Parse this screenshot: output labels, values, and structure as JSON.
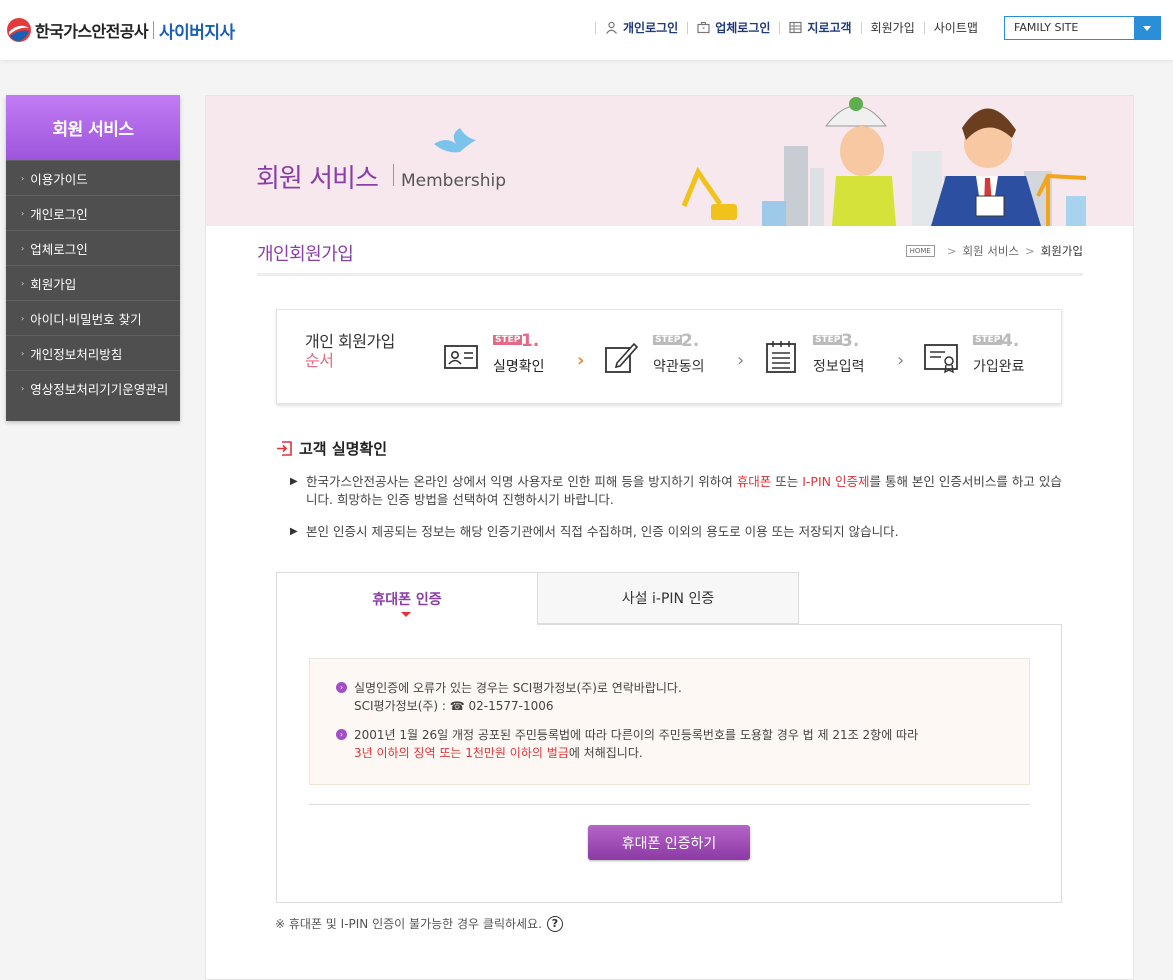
{
  "header": {
    "logo_text": "한국가스안전공사",
    "logo_sub": "사이버지사",
    "nav": [
      {
        "label": "개인로그인"
      },
      {
        "label": "업체로그인"
      },
      {
        "label": "지로고객"
      },
      {
        "label": "회원가입"
      },
      {
        "label": "사이트맵"
      }
    ],
    "family_site": "FAMILY SITE"
  },
  "sidebar": {
    "title": "회원 서비스",
    "items": [
      {
        "label": "이용가이드"
      },
      {
        "label": "개인로그인"
      },
      {
        "label": "업체로그인"
      },
      {
        "label": "회원가입"
      },
      {
        "label": "아이디·비밀번호 찾기"
      },
      {
        "label": "개인정보처리방침"
      },
      {
        "label": "영상정보처리기기운영관리"
      }
    ]
  },
  "banner": {
    "title": "회원 서비스",
    "subtitle": "Membership"
  },
  "page": {
    "title": "개인회원가입",
    "breadcrumb": {
      "home": "HOME",
      "level1": "회원 서비스",
      "level2": "회원가입"
    }
  },
  "steps": {
    "title_line1": "개인 회원가입",
    "title_line2": "순서",
    "badge": "STEP",
    "items": [
      {
        "num": "1.",
        "name": "실명확인"
      },
      {
        "num": "2.",
        "name": "약관동의"
      },
      {
        "num": "3.",
        "name": "정보입력"
      },
      {
        "num": "4.",
        "name": "가입완료"
      }
    ]
  },
  "section": {
    "title": "고객 실명확인",
    "bullet1_a": "한국가스안전공사는 온라인 상에서 익명 사용자로 인한 피해 등을 방지하기 위하여 ",
    "bullet1_red1": "휴대폰",
    "bullet1_b": " 또는 ",
    "bullet1_red2": "I-PIN 인증제",
    "bullet1_c": "를 통해 본인 인증서비스를 하고 있습니다. 희망하는 인증 방법을 선택하여 진행하시기 바랍니다.",
    "bullet2": "본인 인증시 제공되는 정보는 해당 인증기관에서 직접 수집하며, 인증 이외의 용도로 이용 또는 저장되지 않습니다."
  },
  "tabs": [
    {
      "label": "휴대폰 인증"
    },
    {
      "label": "사설 i-PIN 인증"
    }
  ],
  "notice": {
    "n1_line1": "실명인증에 오류가 있는 경우는 SCI평가정보(주)로 연락바랍니다.",
    "n1_line2": "SCI평가정보(주) : ☎ 02-1577-1006",
    "n2_line1": "2001년 1월 26일 개정 공포된 주민등록법에 따라 다른이의 주민등록번호를 도용할 경우 법 제 21조 2항에 따라",
    "n2_red": "3년 이하의 징역 또는 1천만원 이하의 벌금",
    "n2_tail": "에 처해집니다."
  },
  "cta": "휴대폰 인증하기",
  "footnote": "※ 휴대폰 및 I-PIN 인증이 불가능한 경우 클릭하세요.",
  "colors": {
    "accent": "#8a3fa8",
    "red": "#e0343a",
    "blue": "#2a8ed8"
  }
}
